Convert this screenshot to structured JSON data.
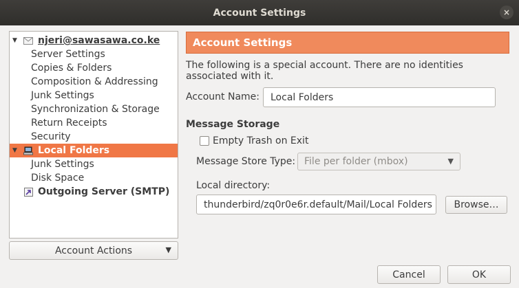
{
  "window": {
    "title": "Account Settings",
    "close_glyph": "×"
  },
  "tree": {
    "items": [
      {
        "label": "njeri@sawasawa.co.ke",
        "icon": "envelope-icon"
      },
      {
        "label": "Server Settings"
      },
      {
        "label": "Copies & Folders"
      },
      {
        "label": "Composition & Addressing"
      },
      {
        "label": "Junk Settings"
      },
      {
        "label": "Synchronization & Storage"
      },
      {
        "label": "Return Receipts"
      },
      {
        "label": "Security"
      },
      {
        "label": "Local Folders",
        "icon": "computer-icon",
        "selected": true
      },
      {
        "label": "Junk Settings"
      },
      {
        "label": "Disk Space"
      },
      {
        "label": "Outgoing Server (SMTP)",
        "icon": "outgoing-server-icon"
      }
    ]
  },
  "account_actions": {
    "label": "Account Actions"
  },
  "panel": {
    "heading": "Account Settings",
    "description": "The following is a special account. There are no identities associated with it.",
    "account_name_label": "Account Name:",
    "account_name_value": "Local Folders",
    "message_storage_heading": "Message Storage",
    "empty_trash_label": "Empty Trash on Exit",
    "empty_trash_checked": false,
    "store_type_label": "Message Store Type:",
    "store_type_value": "File per folder (mbox)",
    "local_directory_label": "Local directory:",
    "local_directory_value": "thunderbird/zq0r0e6r.default/Mail/Local Folders",
    "browse_label": "Browse…"
  },
  "footer": {
    "cancel_label": "Cancel",
    "ok_label": "OK"
  },
  "colors": {
    "accent": "#f07746",
    "banner": "#f08a5c",
    "titlebar": "#3a3835"
  }
}
